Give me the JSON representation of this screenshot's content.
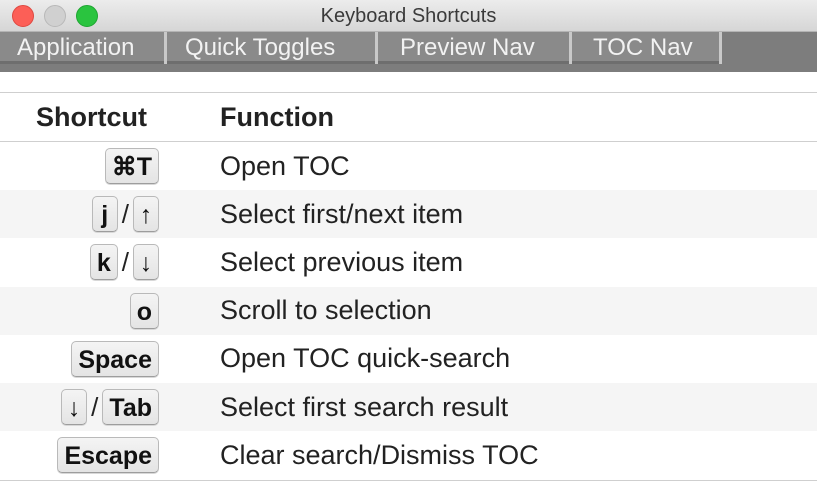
{
  "window": {
    "title": "Keyboard Shortcuts"
  },
  "tabs": [
    {
      "label": "Application"
    },
    {
      "label": "Quick Toggles"
    },
    {
      "label": "Preview Nav"
    },
    {
      "label": "TOC Nav"
    }
  ],
  "table": {
    "headers": {
      "shortcut": "Shortcut",
      "function": "Function"
    },
    "rows": [
      {
        "keys": [
          "⌘T"
        ],
        "separator": "",
        "function": "Open TOC"
      },
      {
        "keys": [
          "j",
          "↑"
        ],
        "separator": "/",
        "function": "Select first/next item"
      },
      {
        "keys": [
          "k",
          "↓"
        ],
        "separator": "/",
        "function": "Select previous item"
      },
      {
        "keys": [
          "o"
        ],
        "separator": "",
        "function": "Scroll to selection"
      },
      {
        "keys": [
          "Space"
        ],
        "separator": "",
        "function": "Open TOC quick-search"
      },
      {
        "keys": [
          "↓",
          "Tab"
        ],
        "separator": "/",
        "function": "Select first search result"
      },
      {
        "keys": [
          "Escape"
        ],
        "separator": "",
        "function": "Clear search/Dismiss TOC"
      }
    ]
  },
  "icons": {
    "close": "close-light-icon",
    "minimize": "minimize-light-icon",
    "zoom": "zoom-light-icon"
  },
  "colors": {
    "close": "#fc5f57",
    "minimize": "#d0d0d0",
    "zoom": "#2ac43f",
    "tabbar": "#7d7d7d"
  }
}
